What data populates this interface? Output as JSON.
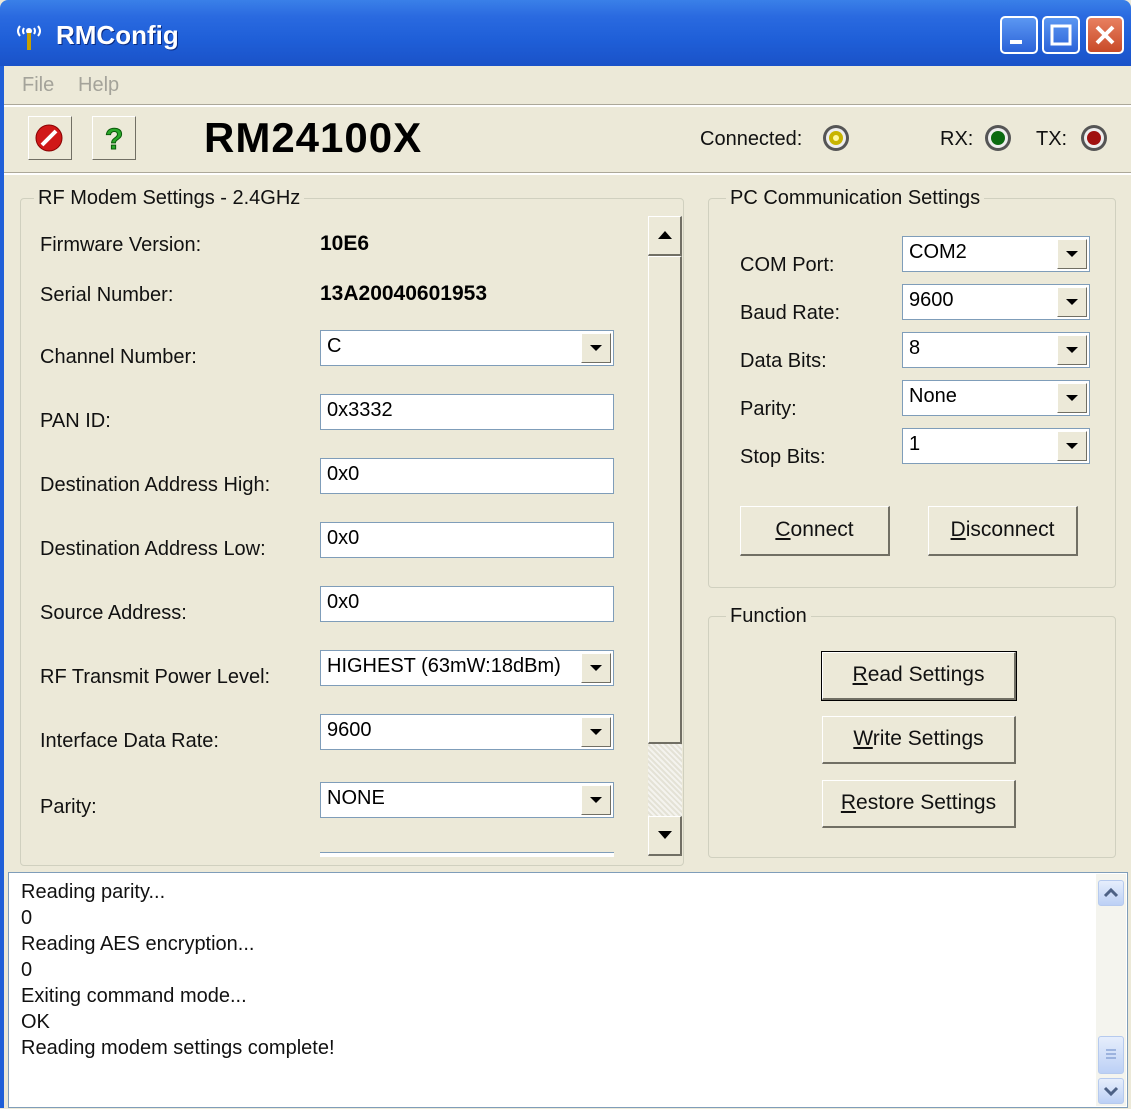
{
  "window": {
    "title": "RMConfig"
  },
  "menu": {
    "items": [
      "File",
      "Help"
    ]
  },
  "toolbar": {
    "model": "RM24100X"
  },
  "status": {
    "connected_label": "Connected:",
    "rx_label": "RX:",
    "tx_label": "TX:",
    "led_colors": {
      "connected": "#c8b400",
      "rx": "#0a6a10",
      "tx": "#a01010"
    }
  },
  "rf_settings": {
    "title": "RF Modem Settings - 2.4GHz",
    "firmware_label": "Firmware Version:",
    "firmware_value": "10E6",
    "serial_label": "Serial Number:",
    "serial_value": "13A20040601953",
    "fields": [
      {
        "label": "Channel Number:",
        "value": "C",
        "type": "combo"
      },
      {
        "label": "PAN ID:",
        "value": "0x3332",
        "type": "text"
      },
      {
        "label": "Destination Address High:",
        "value": "0x0",
        "type": "text"
      },
      {
        "label": "Destination Address Low:",
        "value": "0x0",
        "type": "text"
      },
      {
        "label": "Source Address:",
        "value": "0x0",
        "type": "text"
      },
      {
        "label": "RF Transmit Power Level:",
        "value": "HIGHEST (63mW:18dBm)",
        "type": "combo"
      },
      {
        "label": "Interface Data Rate:",
        "value": "9600",
        "type": "combo"
      },
      {
        "label": "Parity:",
        "value": "NONE",
        "type": "combo"
      }
    ]
  },
  "pc_comm": {
    "title": "PC Communication Settings",
    "fields": [
      {
        "label": "COM Port:",
        "value": "COM2"
      },
      {
        "label": "Baud Rate:",
        "value": "9600"
      },
      {
        "label": "Data Bits:",
        "value": "8"
      },
      {
        "label": "Parity:",
        "value": "None"
      },
      {
        "label": "Stop Bits:",
        "value": "1"
      }
    ],
    "connect": {
      "first": "C",
      "rest": "onnect"
    },
    "disconnect": {
      "first": "D",
      "rest": "isconnect"
    }
  },
  "function": {
    "title": "Function",
    "read": {
      "first": "R",
      "rest": "ead Settings"
    },
    "write": {
      "first": "W",
      "rest": "rite Settings"
    },
    "restore": {
      "first": "R",
      "rest": "estore Settings"
    }
  },
  "log": {
    "lines": [
      "Reading parity...",
      "0",
      "Reading AES encryption...",
      "0",
      "Exiting command mode...",
      "OK",
      "Reading modem settings complete!"
    ]
  }
}
